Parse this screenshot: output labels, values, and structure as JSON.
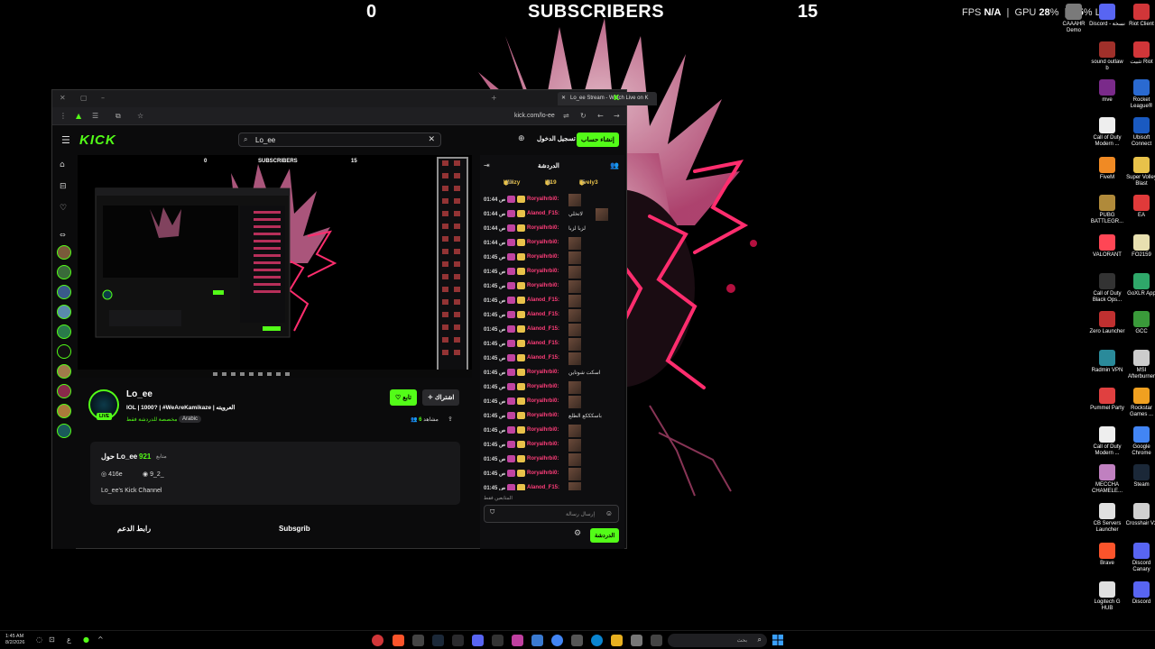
{
  "overlay": {
    "left_count": "0",
    "title": "SUBSCRIBERS",
    "right_count": "15",
    "fps_label": "FPS",
    "fps_value": "N/A",
    "gpu_label": "GPU",
    "gpu_value": "28",
    "gpu_unit": "%",
    "cpu_value": "25",
    "cpu_unit": "%",
    "lat_label": "LAT"
  },
  "desktop_icons": [
    {
      "label": "CAAAHR Demo",
      "color": "#7a7a7a"
    },
    {
      "label": "Discord - نسخة",
      "color": "#5865f2"
    },
    {
      "label": "Riot Client",
      "color": "#d13639"
    },
    {
      "label": "sound outlaw b",
      "color": "#a0302a"
    },
    {
      "label": "تثبيت Riot",
      "color": "#d13639"
    },
    {
      "label": "mve",
      "color": "#7a2a8a"
    },
    {
      "label": "Rocket League®",
      "color": "#2a6ad1"
    },
    {
      "label": "Call of Duty Modern ...",
      "color": "#eeeeee"
    },
    {
      "label": "Ubisoft Connect",
      "color": "#1a5ac1"
    },
    {
      "label": "FiveM",
      "color": "#f08a24"
    },
    {
      "label": "Super Volley Blast",
      "color": "#e8c24a"
    },
    {
      "label": "PUBG BATTLEGR...",
      "color": "#b08a3a"
    },
    {
      "label": "EA",
      "color": "#e03a3a"
    },
    {
      "label": "VALORANT",
      "color": "#ff4655"
    },
    {
      "label": "FO2159",
      "color": "#e8e0b0"
    },
    {
      "label": "Call of Duty Black Ops...",
      "color": "#333333"
    },
    {
      "label": "GoXLR App",
      "color": "#2fa86a"
    },
    {
      "label": "Zero Launcher",
      "color": "#c03030"
    },
    {
      "label": "GCC",
      "color": "#3a9a3a"
    },
    {
      "label": "Radmin VPN",
      "color": "#2a8a9a"
    },
    {
      "label": "MSI Afterburner",
      "color": "#cccccc"
    },
    {
      "label": "Pummel Party",
      "color": "#e04040"
    },
    {
      "label": "Rockstar Games ...",
      "color": "#f0a020"
    },
    {
      "label": "Call of Duty Modern ...",
      "color": "#eeeeee"
    },
    {
      "label": "Google Chrome",
      "color": "#4285f4"
    },
    {
      "label": "MECCHA CHAMELE...",
      "color": "#c080c0"
    },
    {
      "label": "Steam",
      "color": "#1b2838"
    },
    {
      "label": "CB Servers Launcher",
      "color": "#e0e0e0"
    },
    {
      "label": "Crosshair V2",
      "color": "#d0d0d0"
    },
    {
      "label": "Brave",
      "color": "#fb542b"
    },
    {
      "label": "Discord Canary",
      "color": "#5865f2"
    },
    {
      "label": "Logitech G HUB",
      "color": "#e0e0e0"
    },
    {
      "label": "Discord",
      "color": "#5865f2"
    }
  ],
  "browser": {
    "tab_title": "Lo_ee Stream - Watch Live on K",
    "url": "kick.com/lo-ee"
  },
  "kick": {
    "logo": "KICK",
    "search_value": "Lo_ee",
    "login": "تسجيل الدخول",
    "signup": "إنشاء حساب"
  },
  "channel": {
    "name": "Lo_ee",
    "live": "LIVE",
    "title": "IOL | 1000? | #WeAreKamikaze | العرويته",
    "category": "مخصصة للدردشة فقط",
    "language": "Arabic",
    "follow": "تابع",
    "subscribe": "اشتراك",
    "viewers_count": "6",
    "viewers_label": "مشاهد"
  },
  "about": {
    "title": "حول Lo_ee",
    "followers": "921",
    "followers_label": "متابع",
    "instagram": "416e",
    "discord": "9_2_",
    "description": "Lo_ee's Kick Channel"
  },
  "bottom_links": {
    "support": "رابط الدعم",
    "subscribe": "Subsgrib"
  },
  "chat": {
    "title": "الدردشة",
    "gifters": [
      {
        "name": "Wiiizy",
        "count": "10"
      },
      {
        "name": "I719",
        "count": "8"
      },
      {
        "name": "Evely3",
        "count": "5"
      }
    ],
    "messages": [
      {
        "time": "01:44 ص",
        "user": "Roryalhrbi0:",
        "ucolor": "#ff3d7a",
        "text": "",
        "emote": true
      },
      {
        "time": "01:44 ص",
        "user": "Alanod_F15:",
        "ucolor": "#ff3d7a",
        "text": "لاتخلي",
        "emote": true
      },
      {
        "time": "01:44 ص",
        "user": "Roryalhrbi0:",
        "ucolor": "#ff3d7a",
        "text": "لزبا لزبا",
        "emote": false
      },
      {
        "time": "01:44 ص",
        "user": "Roryalhrbi0:",
        "ucolor": "#ff3d7a",
        "text": "",
        "emote": true
      },
      {
        "time": "01:45 ص",
        "user": "Roryalhrbi0:",
        "ucolor": "#ff3d7a",
        "text": "",
        "emote": true
      },
      {
        "time": "01:45 ص",
        "user": "Roryalhrbi0:",
        "ucolor": "#ff3d7a",
        "text": "",
        "emote": true
      },
      {
        "time": "01:45 ص",
        "user": "Roryalhrbi0:",
        "ucolor": "#ff3d7a",
        "text": "",
        "emote": true
      },
      {
        "time": "01:45 ص",
        "user": "Alanod_F15:",
        "ucolor": "#ff3d7a",
        "text": "",
        "emote": true
      },
      {
        "time": "01:45 ص",
        "user": "Alanod_F15:",
        "ucolor": "#ff3d7a",
        "text": "",
        "emote": true
      },
      {
        "time": "01:45 ص",
        "user": "Alanod_F15:",
        "ucolor": "#ff3d7a",
        "text": "",
        "emote": true
      },
      {
        "time": "01:45 ص",
        "user": "Alanod_F15:",
        "ucolor": "#ff3d7a",
        "text": "",
        "emote": true
      },
      {
        "time": "01:45 ص",
        "user": "Alanod_F15:",
        "ucolor": "#ff3d7a",
        "text": "",
        "emote": true
      },
      {
        "time": "01:45 ص",
        "user": "Roryalhrbi0:",
        "ucolor": "#ff3d7a",
        "text": "اسكت شوتاين",
        "emote": false
      },
      {
        "time": "01:45 ص",
        "user": "Roryalhrbi0:",
        "ucolor": "#ff3d7a",
        "text": "",
        "emote": true
      },
      {
        "time": "01:45 ص",
        "user": "Roryalhrbi0:",
        "ucolor": "#ff3d7a",
        "text": "",
        "emote": true
      },
      {
        "time": "01:45 ص",
        "user": "Roryalhrbi0:",
        "ucolor": "#ff3d7a",
        "text": "باسكككع الطلع",
        "emote": false
      },
      {
        "time": "01:45 ص",
        "user": "Roryalhrbi0:",
        "ucolor": "#ff3d7a",
        "text": "",
        "emote": true
      },
      {
        "time": "01:45 ص",
        "user": "Roryalhrbi0:",
        "ucolor": "#ff3d7a",
        "text": "",
        "emote": true
      },
      {
        "time": "01:45 ص",
        "user": "Roryalhrbi0:",
        "ucolor": "#ff3d7a",
        "text": "",
        "emote": true
      },
      {
        "time": "01:45 ص",
        "user": "Roryalhrbi0:",
        "ucolor": "#ff3d7a",
        "text": "",
        "emote": true
      },
      {
        "time": "01:45 ص",
        "user": "Alanod_F15:",
        "ucolor": "#ff3d7a",
        "text": "",
        "emote": true
      }
    ],
    "followers_only": "المتابعين فقط",
    "input_placeholder": "إرسال رسالة",
    "send_button": "الدردشة"
  },
  "taskbar": {
    "time": "1:45 AM",
    "date": "8/2/2026",
    "search_placeholder": "بحث"
  },
  "colors": {
    "kick_green": "#53fc18",
    "chat_user": "#ff3d7a",
    "badge_gold": "#e8c24a"
  }
}
